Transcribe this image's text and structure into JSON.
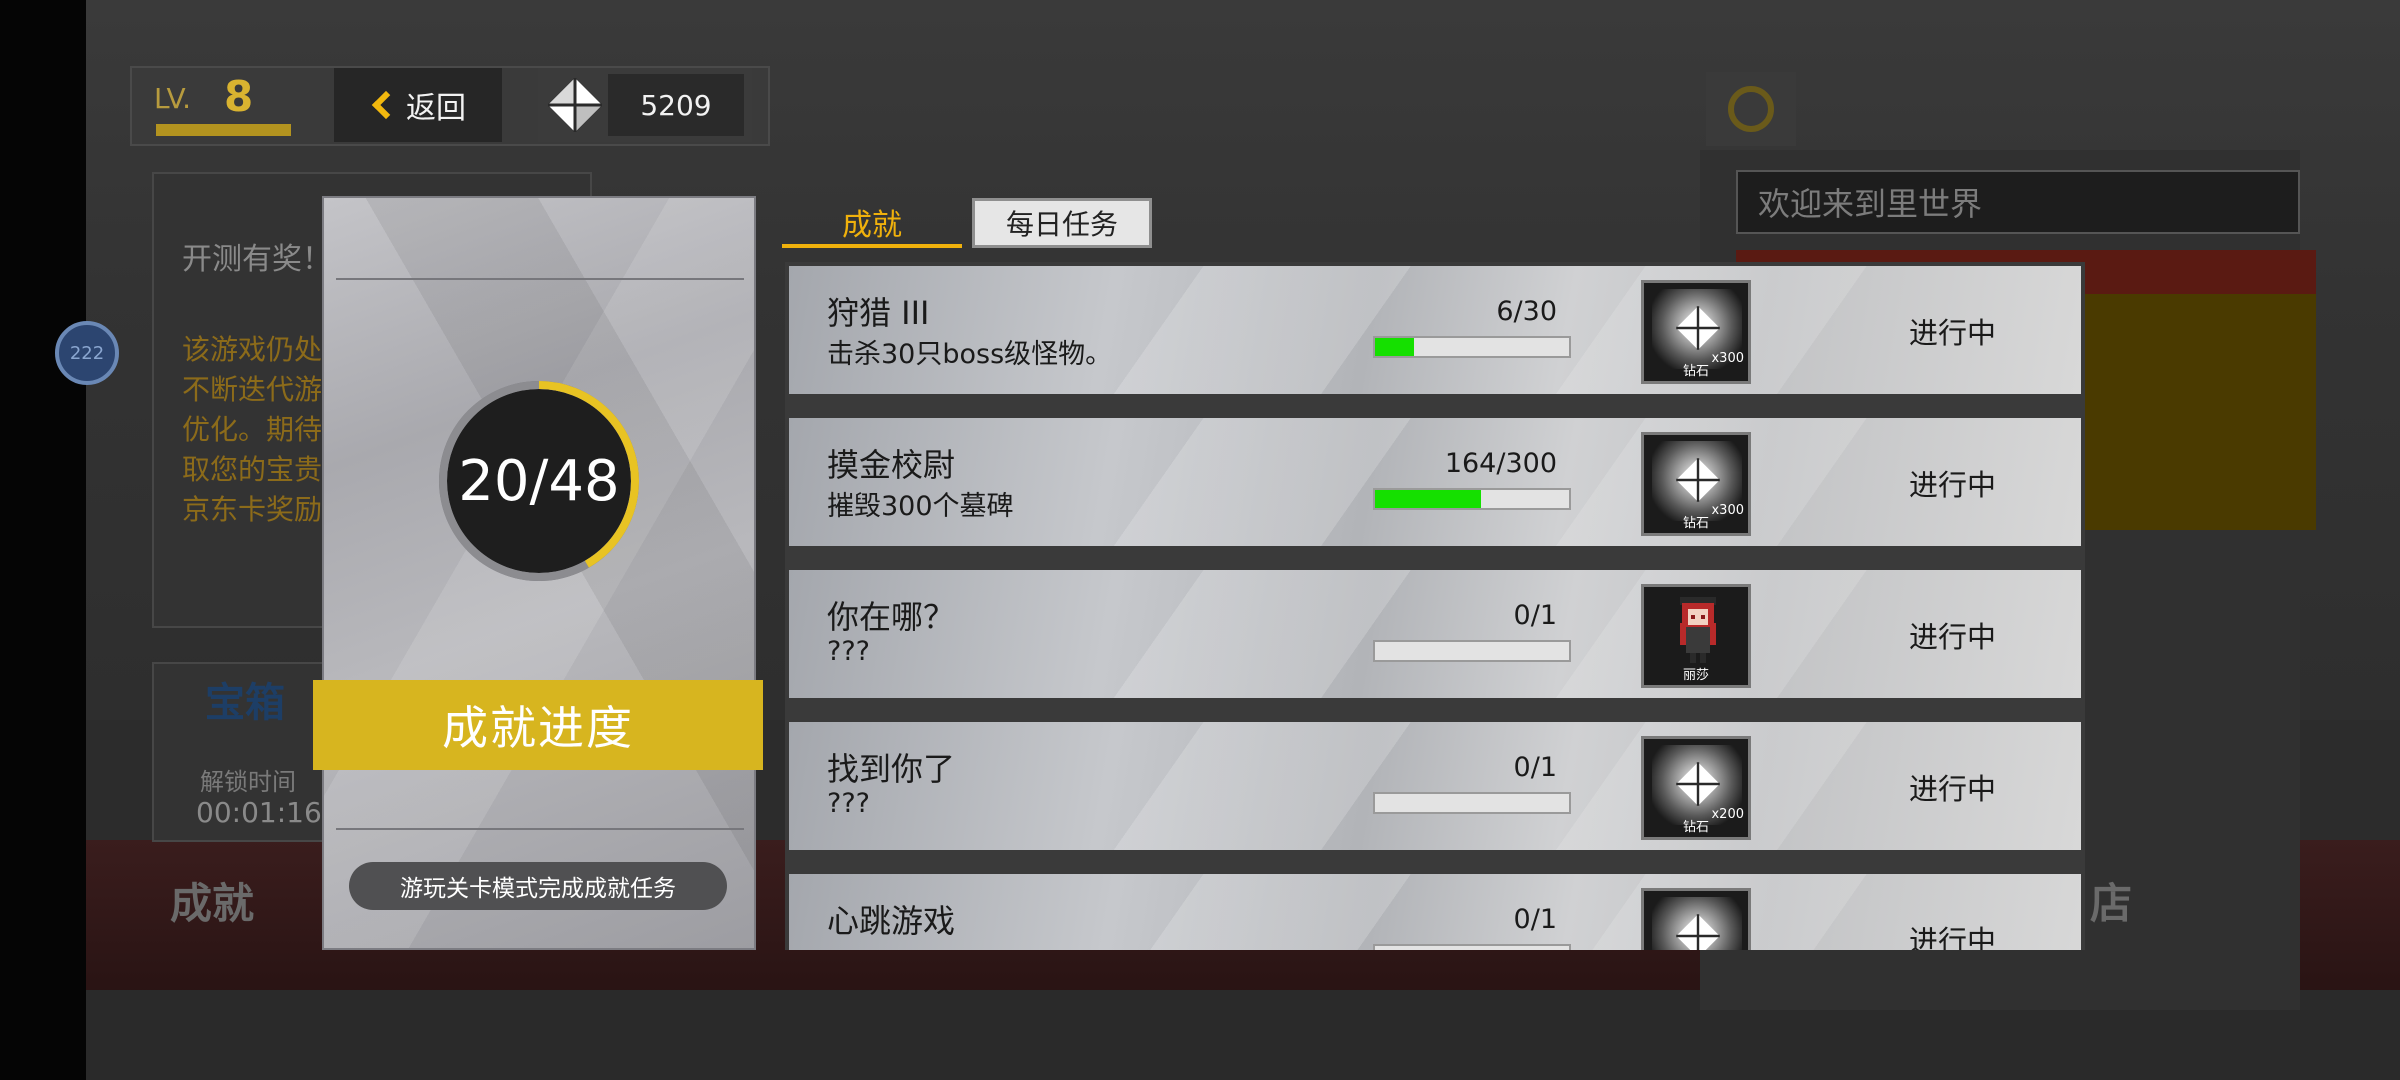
{
  "hud": {
    "level_label": "LV.",
    "level_value": "8",
    "back_label": "返回",
    "currency_value": "5209"
  },
  "background": {
    "card_title": "开测有奖！",
    "card_lines": [
      "该游戏仍处",
      "不断迭代游",
      "优化。期待",
      "取您的宝贵",
      "京东卡奖励"
    ],
    "chest_label": "宝箱",
    "unlock_label": "解锁时间",
    "unlock_time": "00:01:16",
    "achievement_label": "成就",
    "welcome": "欢迎来到里世界",
    "shop_label": "店",
    "float_ball": "222"
  },
  "progress": {
    "count_text": "20/48",
    "completed": 20,
    "total": 48,
    "banner": "成就进度",
    "hint": "游玩关卡模式完成成就任务"
  },
  "tabs": [
    {
      "label": "成就",
      "active": true
    },
    {
      "label": "每日任务",
      "active": false
    }
  ],
  "achievements": [
    {
      "name": "狩猎 III",
      "desc": "击杀30只boss级怪物。",
      "progress_text": "6/30",
      "fraction": 0.2,
      "reward_icon": "diamond-icon",
      "reward_qty": "x300",
      "reward_name": "钻石",
      "status": "进行中"
    },
    {
      "name": "摸金校尉",
      "desc": "摧毁300个墓碑",
      "progress_text": "164/300",
      "fraction": 0.547,
      "reward_icon": "diamond-icon",
      "reward_qty": "x300",
      "reward_name": "钻石",
      "status": "进行中"
    },
    {
      "name": "你在哪？",
      "desc": "???",
      "progress_text": "0/1",
      "fraction": 0,
      "reward_icon": "character-portrait-icon",
      "reward_qty": "",
      "reward_name": "丽莎",
      "status": "进行中"
    },
    {
      "name": "找到你了",
      "desc": "???",
      "progress_text": "0/1",
      "fraction": 0,
      "reward_icon": "diamond-icon",
      "reward_qty": "x200",
      "reward_name": "钻石",
      "status": "进行中"
    },
    {
      "name": "心跳游戏",
      "desc": "",
      "progress_text": "0/1",
      "fraction": 0,
      "reward_icon": "diamond-icon",
      "reward_qty": "",
      "reward_name": "",
      "status": "进行中"
    }
  ],
  "colors": {
    "accent_yellow": "#d7b51f",
    "tab_active": "#f0b10c",
    "progress_green": "#15e000"
  }
}
